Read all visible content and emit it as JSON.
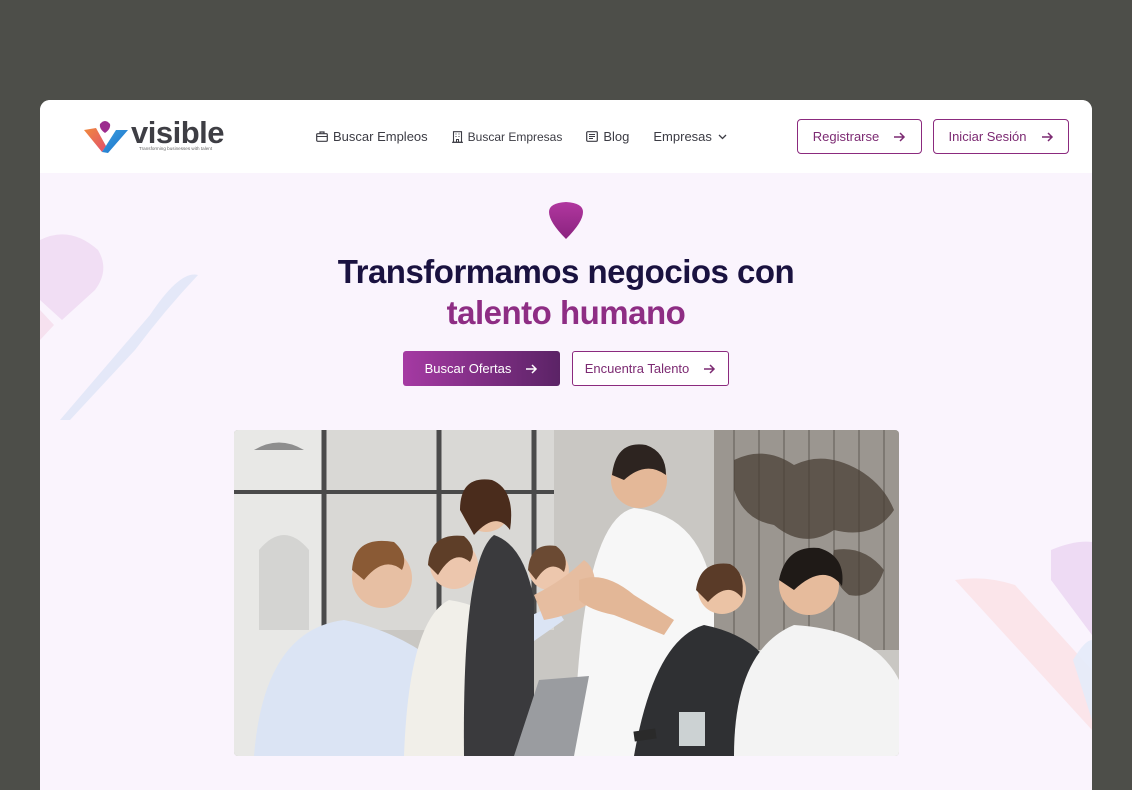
{
  "logo": {
    "name": "visible",
    "tagline": "Transforming businesses with talent"
  },
  "nav": {
    "items": [
      {
        "label": "Buscar Empleos",
        "icon": "briefcase-icon"
      },
      {
        "label": "Buscar Empresas",
        "icon": "building-icon"
      },
      {
        "label": "Blog",
        "icon": "newspaper-icon"
      },
      {
        "label": "Empresas",
        "icon": "chevron-down-icon"
      }
    ]
  },
  "header": {
    "register_label": "Registrarse",
    "login_label": "Iniciar Sesión"
  },
  "hero": {
    "title_line1": "Transformamos negocios con",
    "title_line2": "talento humano",
    "primary_cta": "Buscar Ofertas",
    "secondary_cta": "Encuentra Talento",
    "image_alt": "Equipo celebrando con las manos juntas"
  },
  "colors": {
    "accent_purple": "#8b2a7e",
    "title_navy": "#1a1240",
    "gradient_start": "#a53aa3",
    "gradient_end": "#5b2366",
    "page_bg": "#faf4fd",
    "frame_bg": "#4d4e49"
  }
}
